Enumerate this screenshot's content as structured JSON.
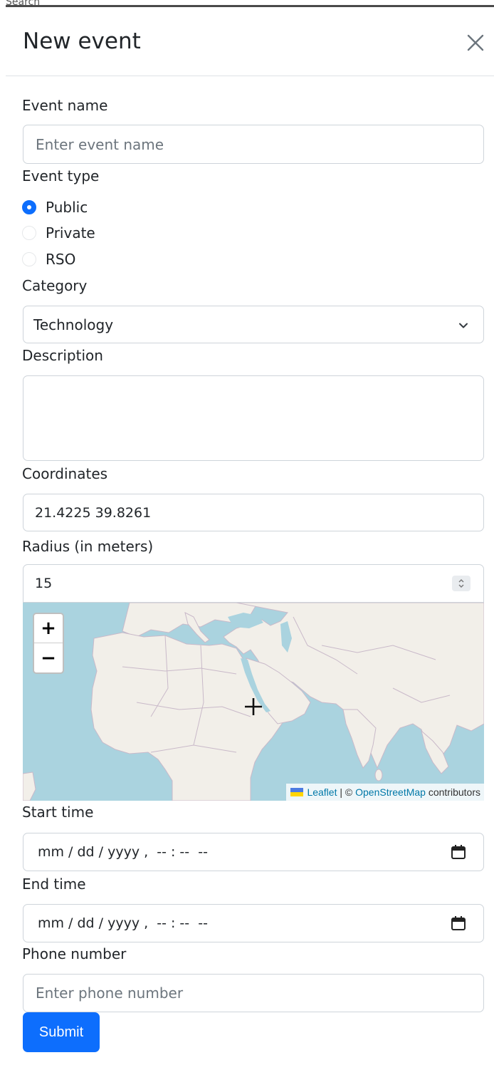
{
  "background_peek_text": "Search",
  "modal": {
    "title": "New event",
    "close_icon": "close-icon"
  },
  "form": {
    "event_name": {
      "label": "Event name",
      "placeholder": "Enter event name",
      "value": ""
    },
    "event_type": {
      "label": "Event type",
      "options": [
        {
          "label": "Public",
          "checked": true
        },
        {
          "label": "Private",
          "checked": false
        },
        {
          "label": "RSO",
          "checked": false
        }
      ]
    },
    "category": {
      "label": "Category",
      "selected": "Technology"
    },
    "description": {
      "label": "Description",
      "value": ""
    },
    "coordinates": {
      "label": "Coordinates",
      "value": "21.4225 39.8261"
    },
    "radius": {
      "label": "Radius (in meters)",
      "value": "15"
    },
    "map": {
      "zoom_in": "+",
      "zoom_out": "−",
      "attribution_leaflet": "Leaflet",
      "attribution_sep": " | © ",
      "attribution_osm": "OpenStreetMap",
      "attribution_tail": " contributors"
    },
    "start_time": {
      "label": "Start time",
      "value": "mm / dd / yyyy ,  -- : --  --"
    },
    "end_time": {
      "label": "End time",
      "value": "mm / dd / yyyy ,  -- : --  --"
    },
    "phone": {
      "label": "Phone number",
      "placeholder": "Enter phone number"
    },
    "submit_label": "Submit"
  },
  "colors": {
    "primary": "#0d6efd",
    "sea": "#aad3df",
    "land": "#f2efe9"
  }
}
